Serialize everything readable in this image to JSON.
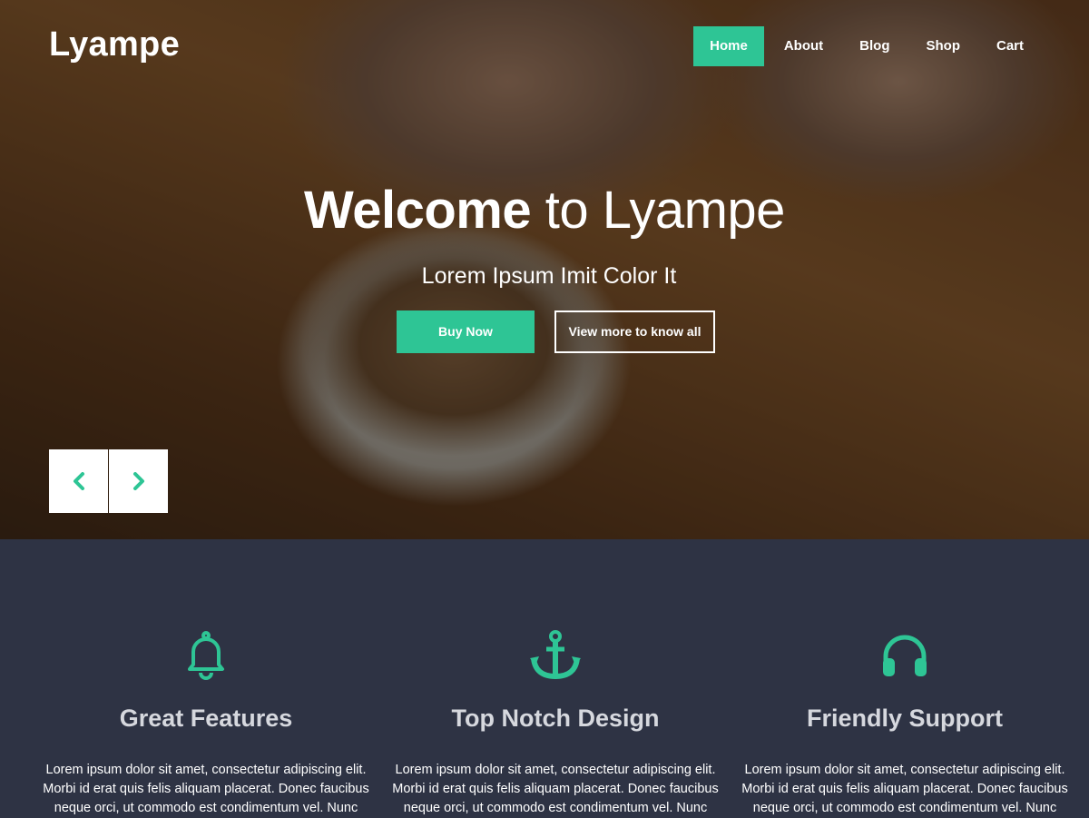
{
  "brand": {
    "logo": "Lyampe",
    "accent": "#2ec595",
    "dark_bg": "#2e3344"
  },
  "nav": {
    "items": [
      {
        "label": "Home",
        "active": true
      },
      {
        "label": "About",
        "active": false
      },
      {
        "label": "Blog",
        "active": false
      },
      {
        "label": "Shop",
        "active": false
      },
      {
        "label": "Cart",
        "active": false
      }
    ]
  },
  "hero": {
    "title_strong": "Welcome",
    "title_rest": " to Lyampe",
    "subtitle": "Lorem Ipsum Imit Color It",
    "primary_button": "Buy Now",
    "secondary_button": "View more to know all",
    "prev_icon": "chevron-left-icon",
    "next_icon": "chevron-right-icon"
  },
  "features": [
    {
      "icon": "bell-icon",
      "title": "Great Features",
      "text": "Lorem ipsum dolor sit amet, consectetur adipiscing elit. Morbi id erat quis felis aliquam placerat. Donec faucibus neque orci, ut commodo est condimentum vel. Nunc"
    },
    {
      "icon": "anchor-icon",
      "title": "Top Notch Design",
      "text": "Lorem ipsum dolor sit amet, consectetur adipiscing elit. Morbi id erat quis felis aliquam placerat. Donec faucibus neque orci, ut commodo est condimentum vel. Nunc"
    },
    {
      "icon": "headphones-icon",
      "title": "Friendly Support",
      "text": "Lorem ipsum dolor sit amet, consectetur adipiscing elit. Morbi id erat quis felis aliquam placerat. Donec faucibus neque orci, ut commodo est condimentum vel. Nunc"
    }
  ]
}
